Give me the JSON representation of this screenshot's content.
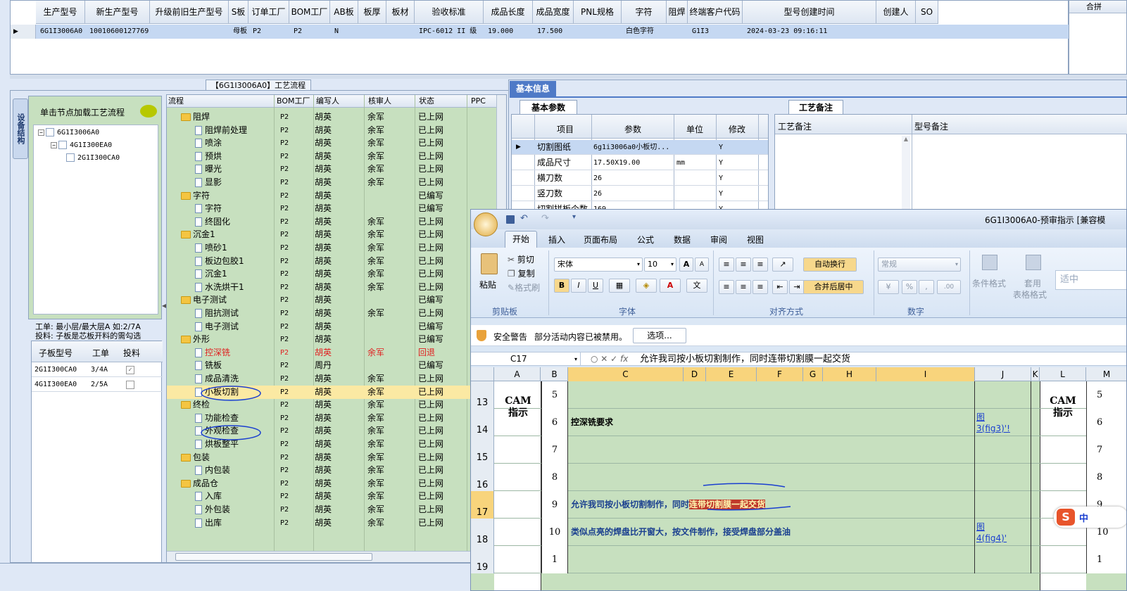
{
  "top_grid": {
    "headers": [
      "生产型号",
      "新生产型号",
      "升级前旧生产型号",
      "S板",
      "订单工厂",
      "BOM工厂",
      "AB板",
      "板厚",
      "板材",
      "验收标准",
      "成品长度",
      "成品宽度",
      "PNL规格",
      "字符",
      "阻焊",
      "终端客户代码",
      "型号创建时间",
      "创建人",
      "SO"
    ],
    "row": [
      "6G1I3006A0",
      "10010600127769",
      "",
      "母板",
      "P2",
      "P2",
      "N",
      "",
      "",
      "IPC-6012 II 级",
      "19.000",
      "17.500",
      "",
      "白色字符",
      "",
      "G1I3",
      "2024-03-23 09:16:11",
      "",
      ""
    ],
    "right_header": "合拼"
  },
  "process_panel": {
    "title": "【6G1I3006A0】工艺流程",
    "side_tab": "设备结构",
    "hint": "单击节点加载工艺流程",
    "tree": [
      "6G1I3006A0",
      "4G1I300EA0",
      "2G1I300CA0"
    ],
    "notice_line1": "工单: 最小层/最大层A 如:2/7A",
    "notice_line2": "投料: 子板是芯板开料的需勾选",
    "sub_headers": [
      "子板型号",
      "工单",
      "投料"
    ],
    "sub_rows": [
      {
        "model": "2G1I300CA0",
        "order": "3/4A",
        "feed": "checked"
      },
      {
        "model": "4G1I300EA0",
        "order": "2/5A",
        "feed": ""
      }
    ]
  },
  "flow": {
    "headers": [
      "流程",
      "BOM工厂",
      "编写人",
      "核审人",
      "状态",
      "PPC"
    ],
    "rows": [
      {
        "name": "阻焊",
        "type": "folder",
        "bom": "P2",
        "writer": "胡英",
        "reviewer": "余军",
        "status": "已上网"
      },
      {
        "name": "阻焊前处理",
        "type": "step",
        "bom": "P2",
        "writer": "胡英",
        "reviewer": "余军",
        "status": "已上网"
      },
      {
        "name": "喷涂",
        "type": "step",
        "bom": "P2",
        "writer": "胡英",
        "reviewer": "余军",
        "status": "已上网"
      },
      {
        "name": "预烘",
        "type": "step",
        "bom": "P2",
        "writer": "胡英",
        "reviewer": "余军",
        "status": "已上网"
      },
      {
        "name": "曝光",
        "type": "step",
        "bom": "P2",
        "writer": "胡英",
        "reviewer": "余军",
        "status": "已上网"
      },
      {
        "name": "显影",
        "type": "step",
        "bom": "P2",
        "writer": "胡英",
        "reviewer": "余军",
        "status": "已上网"
      },
      {
        "name": "字符",
        "type": "folder",
        "bom": "P2",
        "writer": "胡英",
        "reviewer": "",
        "status": "已编写"
      },
      {
        "name": "字符",
        "type": "step",
        "bom": "P2",
        "writer": "胡英",
        "reviewer": "",
        "status": "已编写"
      },
      {
        "name": "终固化",
        "type": "step",
        "bom": "P2",
        "writer": "胡英",
        "reviewer": "余军",
        "status": "已上网"
      },
      {
        "name": "沉金1",
        "type": "folder",
        "bom": "P2",
        "writer": "胡英",
        "reviewer": "余军",
        "status": "已上网"
      },
      {
        "name": "喷砂1",
        "type": "step",
        "bom": "P2",
        "writer": "胡英",
        "reviewer": "余军",
        "status": "已上网"
      },
      {
        "name": "板边包胶1",
        "type": "step",
        "bom": "P2",
        "writer": "胡英",
        "reviewer": "余军",
        "status": "已上网"
      },
      {
        "name": "沉金1",
        "type": "step",
        "bom": "P2",
        "writer": "胡英",
        "reviewer": "余军",
        "status": "已上网"
      },
      {
        "name": "水洗烘干1",
        "type": "step",
        "bom": "P2",
        "writer": "胡英",
        "reviewer": "余军",
        "status": "已上网"
      },
      {
        "name": "电子测试",
        "type": "folder",
        "bom": "P2",
        "writer": "胡英",
        "reviewer": "",
        "status": "已编写"
      },
      {
        "name": "阻抗测试",
        "type": "step",
        "bom": "P2",
        "writer": "胡英",
        "reviewer": "余军",
        "status": "已上网"
      },
      {
        "name": "电子测试",
        "type": "step",
        "bom": "P2",
        "writer": "胡英",
        "reviewer": "",
        "status": "已编写"
      },
      {
        "name": "外形",
        "type": "folder",
        "bom": "P2",
        "writer": "胡英",
        "reviewer": "",
        "status": "已编写"
      },
      {
        "name": "控深铣",
        "type": "step-red",
        "bom": "P2",
        "writer": "胡英",
        "reviewer": "余军",
        "status": "回退"
      },
      {
        "name": "铣板",
        "type": "step",
        "bom": "P2",
        "writer": "周丹",
        "reviewer": "",
        "status": "已编写"
      },
      {
        "name": "成品清洗",
        "type": "step",
        "bom": "P2",
        "writer": "胡英",
        "reviewer": "余军",
        "status": "已上网"
      },
      {
        "name": "小板切割",
        "type": "step-sel",
        "bom": "P2",
        "writer": "胡英",
        "reviewer": "余军",
        "status": "已上网"
      },
      {
        "name": "终检",
        "type": "folder",
        "bom": "P2",
        "writer": "胡英",
        "reviewer": "余军",
        "status": "已上网"
      },
      {
        "name": "功能检查",
        "type": "step",
        "bom": "P2",
        "writer": "胡英",
        "reviewer": "余军",
        "status": "已上网"
      },
      {
        "name": "外观检查",
        "type": "step",
        "bom": "P2",
        "writer": "胡英",
        "reviewer": "余军",
        "status": "已上网"
      },
      {
        "name": "烘板整平",
        "type": "step",
        "bom": "P2",
        "writer": "胡英",
        "reviewer": "余军",
        "status": "已上网"
      },
      {
        "name": "包装",
        "type": "folder",
        "bom": "P2",
        "writer": "胡英",
        "reviewer": "余军",
        "status": "已上网"
      },
      {
        "name": "内包装",
        "type": "step",
        "bom": "P2",
        "writer": "胡英",
        "reviewer": "余军",
        "status": "已上网"
      },
      {
        "name": "成品仓",
        "type": "folder",
        "bom": "P2",
        "writer": "胡英",
        "reviewer": "余军",
        "status": "已上网"
      },
      {
        "name": "入库",
        "type": "step",
        "bom": "P2",
        "writer": "胡英",
        "reviewer": "余军",
        "status": "已上网"
      },
      {
        "name": "外包装",
        "type": "step",
        "bom": "P2",
        "writer": "胡英",
        "reviewer": "余军",
        "status": "已上网"
      },
      {
        "name": "出库",
        "type": "step",
        "bom": "P2",
        "writer": "胡英",
        "reviewer": "余军",
        "status": "已上网"
      }
    ]
  },
  "basic_info": {
    "title": "基本信息",
    "params_tab": "基本参数",
    "notes_tab": "工艺备注",
    "param_headers": [
      "项目",
      "参数",
      "单位",
      "修改"
    ],
    "params": [
      {
        "item": "切割图纸",
        "value": "6g1i3006a0小板切...",
        "unit": "",
        "edit": "Y"
      },
      {
        "item": "成品尺寸",
        "value": "17.50X19.00",
        "unit": "mm",
        "edit": "Y"
      },
      {
        "item": "横刀数",
        "value": "26",
        "unit": "",
        "edit": "Y"
      },
      {
        "item": "竖刀数",
        "value": "26",
        "unit": "",
        "edit": "Y"
      },
      {
        "item": "切割拼板个数",
        "value": "169",
        "unit": "",
        "edit": "Y"
      }
    ],
    "note_headers": [
      "工艺备注",
      "型号备注"
    ]
  },
  "excel": {
    "title": "6G1I3006A0-预审指示 [兼容模",
    "tabs": [
      "开始",
      "插入",
      "页面布局",
      "公式",
      "数据",
      "审阅",
      "视图"
    ],
    "clipboard": {
      "paste": "粘贴",
      "cut": "剪切",
      "copy": "复制",
      "format_painter": "格式刷",
      "label": "剪贴板"
    },
    "font": {
      "name": "宋体",
      "size": "10",
      "label": "字体"
    },
    "align": {
      "wrap": "自动换行",
      "merge": "合并后居中",
      "label": "对齐方式"
    },
    "number": {
      "format": "常规",
      "label": "数字"
    },
    "styles": {
      "cond": "条件格式",
      "apply": "套用",
      "table": "表格格式",
      "fit": "适中"
    },
    "security_title": "安全警告",
    "security_msg": "部分活动内容已被禁用。",
    "options_btn": "选项...",
    "cell_ref": "C17",
    "formula": "允许我司按小板切割制作，同时连带切割膜一起交货",
    "columns": [
      "A",
      "B",
      "C",
      "D",
      "E",
      "F",
      "G",
      "H",
      "I",
      "J",
      "K",
      "L",
      "M"
    ],
    "row_numbers": [
      "13",
      "14",
      "15",
      "16",
      "17",
      "18",
      "19"
    ],
    "cam": "CAM\n指示",
    "rows": [
      {
        "n": "5",
        "text": "",
        "link": ""
      },
      {
        "n": "6",
        "text": "控深铣要求",
        "link": "图\n3(fig3)'!"
      },
      {
        "n": "7",
        "text": "",
        "link": ""
      },
      {
        "n": "8",
        "text": "",
        "link": ""
      },
      {
        "n": "9",
        "text": "允许我司按小板切割制作，同时",
        "highlight": "连带切割膜一起交货",
        "link": ""
      },
      {
        "n": "10",
        "text": "类似点亮的焊盘比开窗大，按文件制作，接受焊盘部分盖油",
        "link": "图\n4(fig4)'"
      },
      {
        "n": "1",
        "text": "",
        "link": ""
      }
    ],
    "right_nums": [
      "5",
      "6",
      "7",
      "8",
      "9",
      "10",
      "1"
    ],
    "ime_label": "中"
  }
}
